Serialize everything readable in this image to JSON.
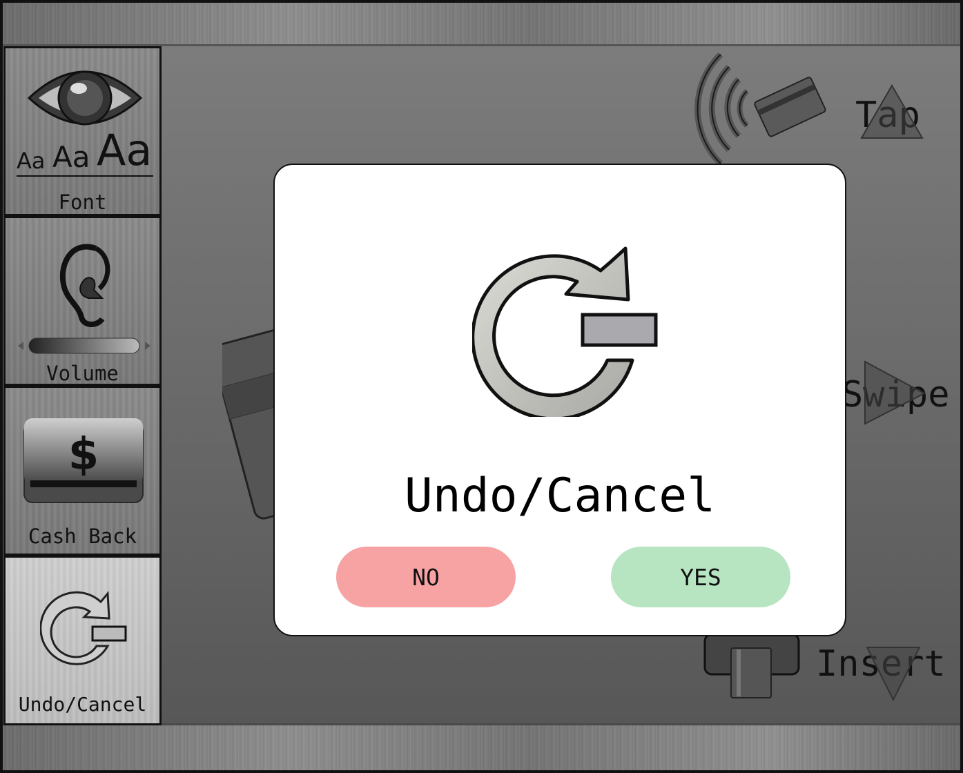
{
  "sidebar": {
    "items": [
      {
        "label": "Font",
        "icon": "eye-font-size-icon"
      },
      {
        "label": "Volume",
        "icon": "ear-icon"
      },
      {
        "label": "Cash Back",
        "icon": "cash-back-icon"
      },
      {
        "label": "Undo/Cancel",
        "icon": "undo-cancel-icon",
        "active": true
      }
    ],
    "font_samples": [
      "Aa",
      "Aa",
      "Aa"
    ]
  },
  "payment": {
    "tap_label": "Tap",
    "swipe_label": "Swipe",
    "insert_label": "Insert"
  },
  "dialog": {
    "title": "Undo/Cancel",
    "no_label": "NO",
    "yes_label": "YES",
    "colors": {
      "no": "#f7a3a3",
      "yes": "#b7e4c1"
    }
  }
}
